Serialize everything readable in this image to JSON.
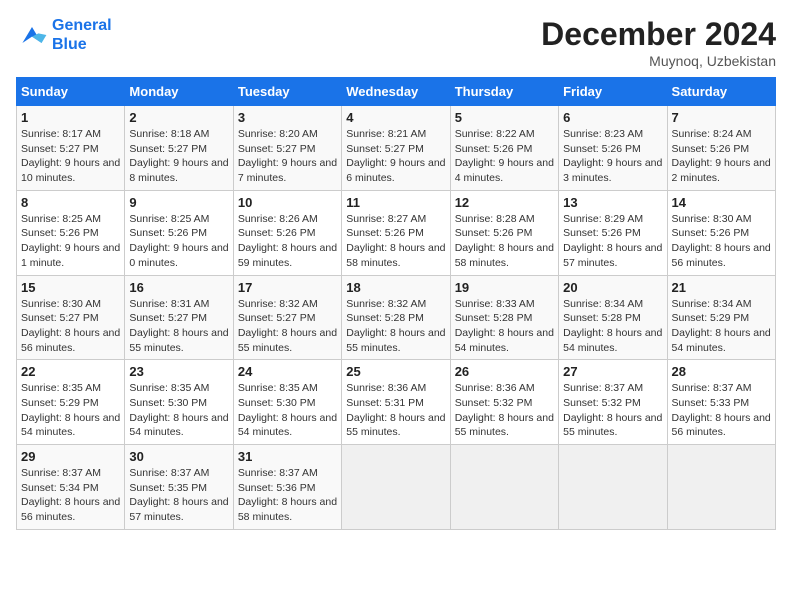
{
  "header": {
    "logo_line1": "General",
    "logo_line2": "Blue",
    "month": "December 2024",
    "location": "Muynoq, Uzbekistan"
  },
  "days_of_week": [
    "Sunday",
    "Monday",
    "Tuesday",
    "Wednesday",
    "Thursday",
    "Friday",
    "Saturday"
  ],
  "weeks": [
    [
      {
        "day": "1",
        "info": "Sunrise: 8:17 AM\nSunset: 5:27 PM\nDaylight: 9 hours and 10 minutes."
      },
      {
        "day": "2",
        "info": "Sunrise: 8:18 AM\nSunset: 5:27 PM\nDaylight: 9 hours and 8 minutes."
      },
      {
        "day": "3",
        "info": "Sunrise: 8:20 AM\nSunset: 5:27 PM\nDaylight: 9 hours and 7 minutes."
      },
      {
        "day": "4",
        "info": "Sunrise: 8:21 AM\nSunset: 5:27 PM\nDaylight: 9 hours and 6 minutes."
      },
      {
        "day": "5",
        "info": "Sunrise: 8:22 AM\nSunset: 5:26 PM\nDaylight: 9 hours and 4 minutes."
      },
      {
        "day": "6",
        "info": "Sunrise: 8:23 AM\nSunset: 5:26 PM\nDaylight: 9 hours and 3 minutes."
      },
      {
        "day": "7",
        "info": "Sunrise: 8:24 AM\nSunset: 5:26 PM\nDaylight: 9 hours and 2 minutes."
      }
    ],
    [
      {
        "day": "8",
        "info": "Sunrise: 8:25 AM\nSunset: 5:26 PM\nDaylight: 9 hours and 1 minute."
      },
      {
        "day": "9",
        "info": "Sunrise: 8:25 AM\nSunset: 5:26 PM\nDaylight: 9 hours and 0 minutes."
      },
      {
        "day": "10",
        "info": "Sunrise: 8:26 AM\nSunset: 5:26 PM\nDaylight: 8 hours and 59 minutes."
      },
      {
        "day": "11",
        "info": "Sunrise: 8:27 AM\nSunset: 5:26 PM\nDaylight: 8 hours and 58 minutes."
      },
      {
        "day": "12",
        "info": "Sunrise: 8:28 AM\nSunset: 5:26 PM\nDaylight: 8 hours and 58 minutes."
      },
      {
        "day": "13",
        "info": "Sunrise: 8:29 AM\nSunset: 5:26 PM\nDaylight: 8 hours and 57 minutes."
      },
      {
        "day": "14",
        "info": "Sunrise: 8:30 AM\nSunset: 5:26 PM\nDaylight: 8 hours and 56 minutes."
      }
    ],
    [
      {
        "day": "15",
        "info": "Sunrise: 8:30 AM\nSunset: 5:27 PM\nDaylight: 8 hours and 56 minutes."
      },
      {
        "day": "16",
        "info": "Sunrise: 8:31 AM\nSunset: 5:27 PM\nDaylight: 8 hours and 55 minutes."
      },
      {
        "day": "17",
        "info": "Sunrise: 8:32 AM\nSunset: 5:27 PM\nDaylight: 8 hours and 55 minutes."
      },
      {
        "day": "18",
        "info": "Sunrise: 8:32 AM\nSunset: 5:28 PM\nDaylight: 8 hours and 55 minutes."
      },
      {
        "day": "19",
        "info": "Sunrise: 8:33 AM\nSunset: 5:28 PM\nDaylight: 8 hours and 54 minutes."
      },
      {
        "day": "20",
        "info": "Sunrise: 8:34 AM\nSunset: 5:28 PM\nDaylight: 8 hours and 54 minutes."
      },
      {
        "day": "21",
        "info": "Sunrise: 8:34 AM\nSunset: 5:29 PM\nDaylight: 8 hours and 54 minutes."
      }
    ],
    [
      {
        "day": "22",
        "info": "Sunrise: 8:35 AM\nSunset: 5:29 PM\nDaylight: 8 hours and 54 minutes."
      },
      {
        "day": "23",
        "info": "Sunrise: 8:35 AM\nSunset: 5:30 PM\nDaylight: 8 hours and 54 minutes."
      },
      {
        "day": "24",
        "info": "Sunrise: 8:35 AM\nSunset: 5:30 PM\nDaylight: 8 hours and 54 minutes."
      },
      {
        "day": "25",
        "info": "Sunrise: 8:36 AM\nSunset: 5:31 PM\nDaylight: 8 hours and 55 minutes."
      },
      {
        "day": "26",
        "info": "Sunrise: 8:36 AM\nSunset: 5:32 PM\nDaylight: 8 hours and 55 minutes."
      },
      {
        "day": "27",
        "info": "Sunrise: 8:37 AM\nSunset: 5:32 PM\nDaylight: 8 hours and 55 minutes."
      },
      {
        "day": "28",
        "info": "Sunrise: 8:37 AM\nSunset: 5:33 PM\nDaylight: 8 hours and 56 minutes."
      }
    ],
    [
      {
        "day": "29",
        "info": "Sunrise: 8:37 AM\nSunset: 5:34 PM\nDaylight: 8 hours and 56 minutes."
      },
      {
        "day": "30",
        "info": "Sunrise: 8:37 AM\nSunset: 5:35 PM\nDaylight: 8 hours and 57 minutes."
      },
      {
        "day": "31",
        "info": "Sunrise: 8:37 AM\nSunset: 5:36 PM\nDaylight: 8 hours and 58 minutes."
      },
      null,
      null,
      null,
      null
    ]
  ]
}
